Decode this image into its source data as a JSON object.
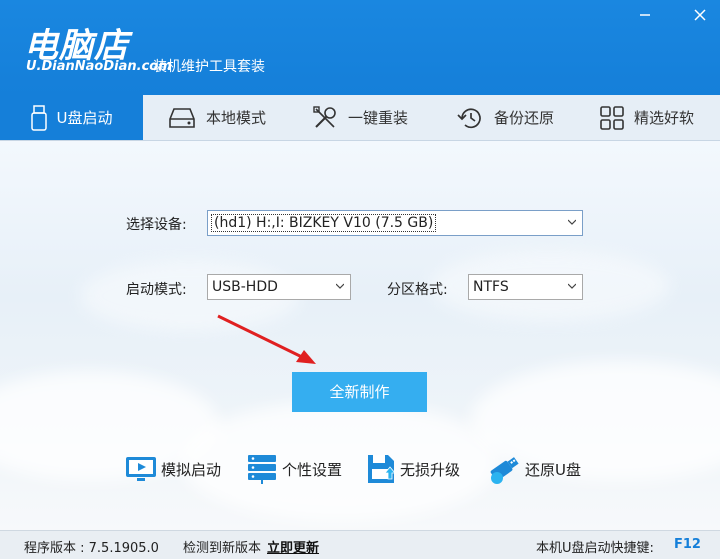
{
  "header": {
    "logo_cn": "电脑店",
    "logo_en": "U.DianNaoDian.com",
    "subtitle": "装机维护工具套装"
  },
  "nav": {
    "tabs": [
      {
        "label": "U盘启动",
        "icon": "usb-drive-icon"
      },
      {
        "label": "本地模式",
        "icon": "hard-disk-icon"
      },
      {
        "label": "一键重装",
        "icon": "tools-icon"
      },
      {
        "label": "备份还原",
        "icon": "restore-clock-icon"
      },
      {
        "label": "精选好软",
        "icon": "apps-grid-icon"
      }
    ]
  },
  "form": {
    "device_label": "选择设备:",
    "device_value": "(hd1) H:,I: BIZKEY V10 (7.5 GB)",
    "boot_mode_label": "启动模式:",
    "boot_mode_value": "USB-HDD",
    "partition_label": "分区格式:",
    "partition_value": "NTFS",
    "create_button": "全新制作"
  },
  "tools": [
    {
      "label": "模拟启动",
      "icon": "monitor-play-icon"
    },
    {
      "label": "个性设置",
      "icon": "server-settings-icon"
    },
    {
      "label": "无损升级",
      "icon": "upgrade-disk-icon"
    },
    {
      "label": "还原U盘",
      "icon": "usb-restore-icon"
    }
  ],
  "status": {
    "version_label": "程序版本 : 7.5.1905.0",
    "update_text": "检测到新版本",
    "update_link": "立即更新",
    "hotkey_label": "本机U盘启动快捷键:",
    "hotkey_value": "F12"
  },
  "colors": {
    "brand_blue": "#157fd9",
    "button_blue": "#35aef0",
    "arrow_red": "#e02020"
  }
}
